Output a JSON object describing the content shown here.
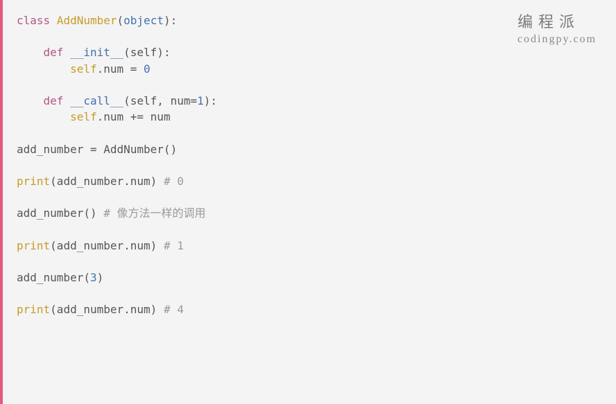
{
  "watermark": {
    "cn": "编程派",
    "en": "codingpy.com"
  },
  "code": {
    "l1_class": "class",
    "l1_name": "AddNumber",
    "l1_object": "object",
    "l1_end": "):",
    "l3_def": "def",
    "l3_name": "__init__",
    "l3_params": "(self):",
    "l4_self": "self",
    "l4_dot_prop": ".num ",
    "l4_eq": "= ",
    "l4_val": "0",
    "l6_def": "def",
    "l6_name": "__call__",
    "l6_open": "(self, num=",
    "l6_default": "1",
    "l6_close": "):",
    "l7_self": "self",
    "l7_dot_prop": ".num ",
    "l7_op": "+= ",
    "l7_rhs": "num",
    "l9_lhs": "add_number ",
    "l9_eq": "= ",
    "l9_rhs": "AddNumber()",
    "l11_fn": "print",
    "l11_args": "(add_number.num) ",
    "l11_comment": "# 0",
    "l13_call": "add_number() ",
    "l13_comment": "# 像方法一样的调用",
    "l15_fn": "print",
    "l15_args": "(add_number.num) ",
    "l15_comment": "# 1",
    "l17_call_open": "add_number(",
    "l17_arg": "3",
    "l17_call_close": ")",
    "l19_fn": "print",
    "l19_args": "(add_number.num) ",
    "l19_comment": "# 4"
  }
}
